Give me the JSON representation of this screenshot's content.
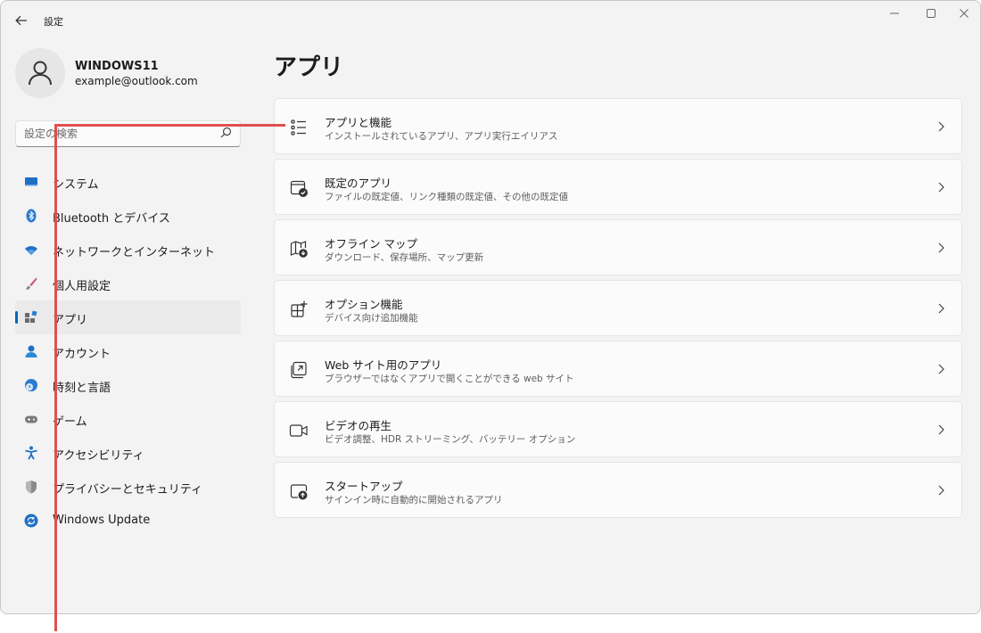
{
  "window": {
    "title": "設定"
  },
  "profile": {
    "name": "WINDOWS11",
    "email": "example@outlook.com"
  },
  "search": {
    "placeholder": "設定の検索"
  },
  "nav": {
    "items": [
      {
        "label": "システム",
        "icon": "monitor-icon"
      },
      {
        "label": "Bluetooth とデバイス",
        "icon": "bluetooth-icon"
      },
      {
        "label": "ネットワークとインターネット",
        "icon": "wifi-icon"
      },
      {
        "label": "個人用設定",
        "icon": "brush-icon"
      },
      {
        "label": "アプリ",
        "icon": "apps-icon",
        "active": true
      },
      {
        "label": "アカウント",
        "icon": "person-icon"
      },
      {
        "label": "時刻と言語",
        "icon": "globe-clock-icon"
      },
      {
        "label": "ゲーム",
        "icon": "gamepad-icon"
      },
      {
        "label": "アクセシビリティ",
        "icon": "accessibility-icon"
      },
      {
        "label": "プライバシーとセキュリティ",
        "icon": "shield-icon"
      },
      {
        "label": "Windows Update",
        "icon": "update-icon"
      }
    ]
  },
  "main": {
    "title": "アプリ",
    "cards": [
      {
        "title": "アプリと機能",
        "subtitle": "インストールされているアプリ、アプリ実行エイリアス",
        "icon": "list-icon"
      },
      {
        "title": "既定のアプリ",
        "subtitle": "ファイルの既定値、リンク種類の既定値、その他の既定値",
        "icon": "default-apps-icon"
      },
      {
        "title": "オフライン マップ",
        "subtitle": "ダウンロード、保存場所、マップ更新",
        "icon": "map-icon"
      },
      {
        "title": "オプション機能",
        "subtitle": "デバイス向け追加機能",
        "icon": "add-feature-icon"
      },
      {
        "title": "Web サイト用のアプリ",
        "subtitle": "ブラウザーではなくアプリで開くことができる web サイト",
        "icon": "open-link-icon"
      },
      {
        "title": "ビデオの再生",
        "subtitle": "ビデオ調整、HDR ストリーミング、バッテリー オプション",
        "icon": "video-icon"
      },
      {
        "title": "スタートアップ",
        "subtitle": "サインイン時に自動的に開始されるアプリ",
        "icon": "startup-icon"
      }
    ]
  },
  "colors": {
    "accent": "#0067c0",
    "annotation": "#e05050",
    "background": "#f3f3f3"
  }
}
